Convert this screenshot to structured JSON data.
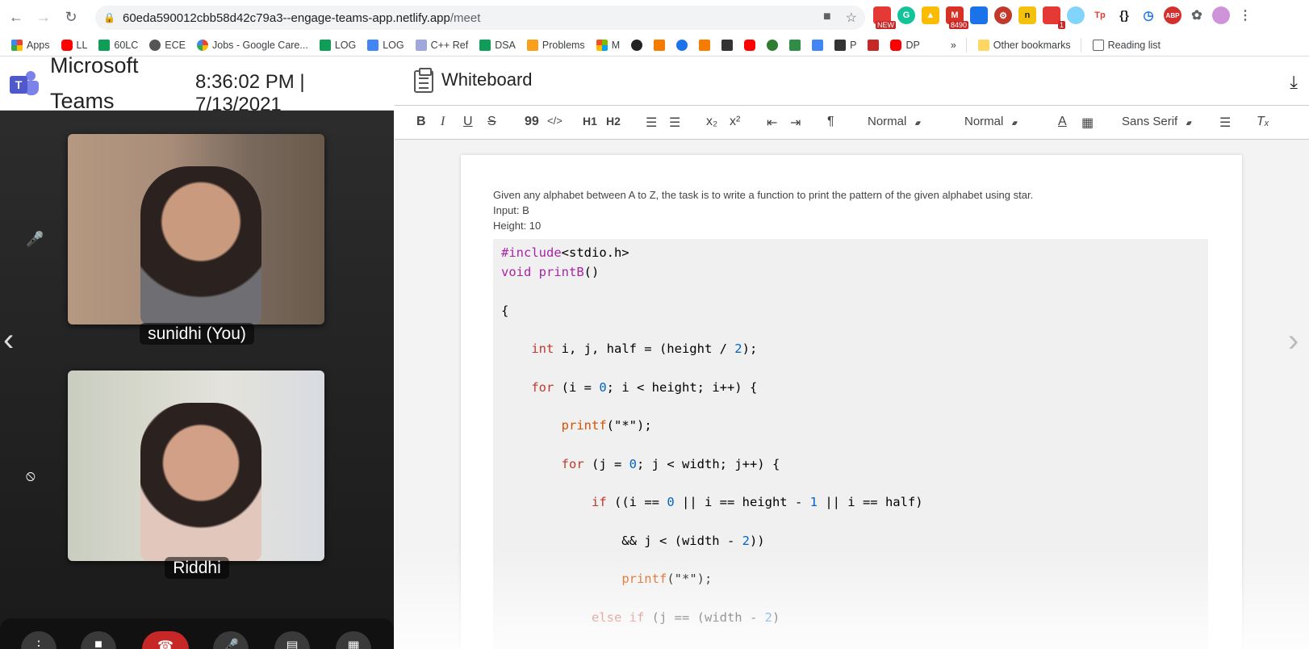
{
  "browser": {
    "url_host": "60eda590012cbb58d42c79a3--engage-teams-app.netlify.app",
    "url_path": "/meet",
    "bookmarks": [
      "Apps",
      "LL",
      "60LC",
      "ECE",
      "Jobs - Google Care...",
      "LOG",
      "LOG",
      "C++ Ref",
      "DSA",
      "Problems",
      "M",
      "P",
      "DP"
    ],
    "bookmarks_more": "»",
    "other_bookmarks": "Other bookmarks",
    "reading_list": "Reading list",
    "ext_badges": {
      "new": "NEW",
      "gmail": "8490",
      "todo": "1"
    }
  },
  "call": {
    "app_title": "Microsoft Teams",
    "clock": "8:36:02 PM | 7/13/2021",
    "participants": [
      {
        "name": "sunidhi (You)"
      },
      {
        "name": "Riddhi"
      }
    ]
  },
  "whiteboard": {
    "title": "Whiteboard",
    "toolbar": {
      "bold": "B",
      "italic": "I",
      "underline": "U",
      "strike": "S",
      "quote": "99",
      "code": "</>",
      "h1": "H1",
      "h2": "H2",
      "sub": "x₂",
      "sup": "x²",
      "size_select": "Normal",
      "heading_select": "Normal",
      "font_select": "Sans Serif"
    },
    "prompt": "Given any alphabet between A to Z, the task is to write a function to print the pattern of the given alphabet using star.",
    "input_line": "Input: B",
    "height_line": "Height: 10"
  }
}
